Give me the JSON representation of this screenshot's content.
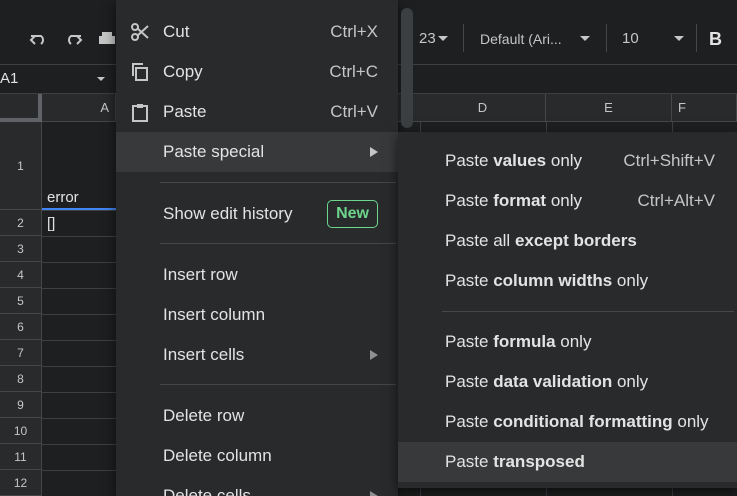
{
  "toolbar": {
    "zoom_text": "23",
    "font_name": "Default (Ari...",
    "font_size": "10",
    "bold_label": "B",
    "undo_icon": "undo-icon",
    "redo_icon": "redo-icon",
    "print_icon": "print-icon"
  },
  "namebox": {
    "value": "A1"
  },
  "columns": [
    "A",
    "D",
    "E",
    "F"
  ],
  "rows": [
    "1",
    "2",
    "3",
    "4",
    "5",
    "6",
    "7",
    "8",
    "9",
    "10",
    "11",
    "12"
  ],
  "cells": {
    "A1": "error",
    "A2": "[]"
  },
  "menu": {
    "cut": {
      "label": "Cut",
      "shortcut": "Ctrl+X",
      "icon": "scissors-icon"
    },
    "copy": {
      "label": "Copy",
      "shortcut": "Ctrl+C",
      "icon": "copy-icon"
    },
    "paste": {
      "label": "Paste",
      "shortcut": "Ctrl+V",
      "icon": "clipboard-icon"
    },
    "paste_special": {
      "label": "Paste special"
    },
    "show_edit_history": {
      "label": "Show edit history",
      "badge": "New"
    },
    "insert_row": {
      "label": "Insert row"
    },
    "insert_column": {
      "label": "Insert column"
    },
    "insert_cells": {
      "label": "Insert cells"
    },
    "delete_row": {
      "label": "Delete row"
    },
    "delete_column": {
      "label": "Delete column"
    },
    "delete_cells": {
      "label": "Delete cells"
    }
  },
  "submenu": {
    "values_only": {
      "pre": "Paste ",
      "bold": "values",
      "post": " only",
      "shortcut": "Ctrl+Shift+V"
    },
    "format_only": {
      "pre": "Paste ",
      "bold": "format",
      "post": " only",
      "shortcut": "Ctrl+Alt+V"
    },
    "all_except_borders": {
      "pre": "Paste all ",
      "bold": "except borders",
      "post": ""
    },
    "column_widths_only": {
      "pre": "Paste ",
      "bold": "column widths",
      "post": " only"
    },
    "formula_only": {
      "pre": "Paste ",
      "bold": "formula",
      "post": " only"
    },
    "data_validation_only": {
      "pre": "Paste ",
      "bold": "data validation",
      "post": " only"
    },
    "conditional_formatting_only": {
      "pre": "Paste ",
      "bold": "conditional formatting",
      "post": " only"
    },
    "transposed": {
      "pre": "Paste ",
      "bold": "transposed",
      "post": ""
    }
  },
  "colors": {
    "menu_bg": "#282a2c",
    "hover_bg": "#37393b",
    "badge_green": "#6dd58c",
    "selection_blue": "#4285f4"
  }
}
